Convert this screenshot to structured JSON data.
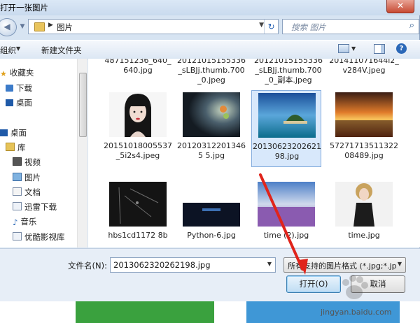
{
  "window": {
    "title": "打开一张图片",
    "close": "✕"
  },
  "nav": {
    "location": "图片",
    "search_placeholder": "搜索 图片"
  },
  "toolbar": {
    "organize": "组织",
    "new_folder": "新建文件夹"
  },
  "sidebar": {
    "items": [
      {
        "label": "收藏夹",
        "icon": "star-icon"
      },
      {
        "label": "下载",
        "icon": "download-folder-icon"
      },
      {
        "label": "桌面",
        "icon": "desktop-icon"
      },
      {
        "label": "桌面",
        "icon": "desktop-icon"
      },
      {
        "label": "库",
        "icon": "library-icon"
      },
      {
        "label": "视频",
        "icon": "video-library-icon"
      },
      {
        "label": "图片",
        "icon": "pictures-library-icon"
      },
      {
        "label": "文档",
        "icon": "documents-library-icon"
      },
      {
        "label": "迅雷下载",
        "icon": "thunder-download-icon"
      },
      {
        "label": "音乐",
        "icon": "music-library-icon"
      },
      {
        "label": "优酷影视库",
        "icon": "youku-library-icon"
      }
    ]
  },
  "files_top_row": [
    "487151236_640_640.jpg",
    "20121015155336_sLBJj.thumb.700_0.jpeg",
    "20121015155336_sLBJj.thumb.700_0_副本.jpeg",
    "201411071644l2_v284V.jpeg"
  ],
  "files": [
    {
      "name": "20151018005537_5i2s4.jpeg",
      "selected": false
    },
    {
      "name": "201203122013465 5.jpg",
      "selected": false
    },
    {
      "name": "20130623202621 98.jpg",
      "selected": true
    },
    {
      "name": "5727171351132208489.jpg",
      "selected": false
    },
    {
      "name": "hbs1cd1172 8b",
      "selected": false
    },
    {
      "name": "Python-6.jpg",
      "selected": false
    },
    {
      "name": "time (2).jpg",
      "selected": false
    },
    {
      "name": "time.jpg",
      "selected": false
    }
  ],
  "footer": {
    "filename_label": "文件名(N):",
    "filename_value": "2013062320262198.jpg",
    "filetype_value": "所有支持的图片格式 (*.jpg;*.jp",
    "open_label": "打开(O)",
    "cancel_label": "取消"
  },
  "watermark": "jingyan.baidu.com"
}
